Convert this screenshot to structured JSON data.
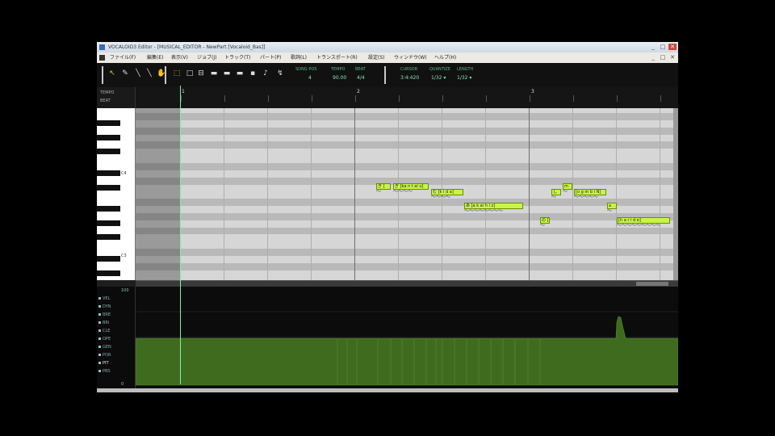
{
  "window": {
    "title": "VOCALOID3 Editor - [MUSICAL_EDITOR - NewPart [Vocaloid_Bas]]",
    "controls": [
      "_",
      "□",
      "✕"
    ]
  },
  "menu": {
    "items": [
      "ファイル(F)",
      "編集(E)",
      "表示(V)",
      "ジョブ(J)",
      "トラック(T)",
      "パート(P)",
      "歌詞(L)",
      "トランスポート(R)",
      "設定(S)",
      "ウィンドウ(W)",
      "ヘルプ(H)"
    ],
    "controls": [
      "_",
      "□",
      "✕"
    ]
  },
  "toolbar": {
    "tools": [
      {
        "name": "pointer-tool",
        "glyph": "↖",
        "active": true
      },
      {
        "name": "pencil-tool",
        "glyph": "✎",
        "active": false
      },
      {
        "name": "line-tool",
        "glyph": "╲",
        "active": false
      },
      {
        "name": "eraser-tool",
        "glyph": "╲",
        "active": false
      },
      {
        "name": "hand-tool",
        "glyph": "✋",
        "active": false
      }
    ],
    "tools2": [
      {
        "name": "select-tool",
        "glyph": "⬚",
        "active": true
      },
      {
        "name": "box-tool",
        "glyph": "□",
        "active": false
      },
      {
        "name": "grid-tool",
        "glyph": "⊟",
        "active": false
      },
      {
        "name": "stop-tool",
        "glyph": "▬",
        "active": false
      },
      {
        "name": "rewind-tool",
        "glyph": "▬",
        "active": false
      },
      {
        "name": "play-tool",
        "glyph": "▬",
        "active": false
      },
      {
        "name": "dot-tool",
        "glyph": "▪",
        "active": false
      },
      {
        "name": "note-tool",
        "glyph": "♪",
        "active": false
      },
      {
        "name": "rest-tool",
        "glyph": "↯",
        "active": false
      }
    ],
    "song_pos_label": "SONG POS",
    "tempo_label": "TEMPO",
    "beat_label": "BEAT",
    "song_pos": "4",
    "tempo": "90.00",
    "beat": "4/4",
    "cursor_label": "CURSOR",
    "quantize_label": "QUANTIZE",
    "length_label": "LENGTH",
    "cursor": "3:4:420",
    "quantize": "1/32 ▾",
    "length": "1/32 ▾"
  },
  "ruler": {
    "labels": [
      "TEMPO",
      "BEAT"
    ],
    "bars": [
      "1",
      "2",
      "3"
    ]
  },
  "keyboard": {
    "labels": [
      "C4",
      "C3"
    ]
  },
  "notes": [
    {
      "lyric": "ぎ [",
      "wave": "〜"
    },
    {
      "lyric": "ぎ [ka n t ai u]",
      "wave": "〜〜〜〜"
    },
    {
      "lyric": "む [k i d a]",
      "wave": "〜〜〜〜"
    },
    {
      "lyric": "あ [a k ai h i z]",
      "wave": "〜〜〜〜〜〜〜〜"
    },
    {
      "lyric": "の [",
      "wave": "〜"
    },
    {
      "lyric": "し",
      "wave": "〜"
    },
    {
      "lyric": "m",
      "wave": "〜"
    },
    {
      "lyric": "[o g m b i N]",
      "wave": "〜〜〜〜〜"
    },
    {
      "lyric": "a",
      "wave": "〜"
    },
    {
      "lyric": "[h a r i d e]",
      "wave": "〜〜〜〜〜〜〜〜〜"
    }
  ],
  "controller": {
    "top_label": "100",
    "bottom_label": "0",
    "params": [
      "VEL",
      "DYN",
      "BRE",
      "BRI",
      "CLE",
      "OPE",
      "GEN",
      "POR",
      "PIT",
      "PBS"
    ],
    "selected": "PIT"
  },
  "colors": {
    "note_fill": "#c8f545",
    "ctrl_fill": "#3f6b1f",
    "playhead": "#7cf0b0"
  }
}
